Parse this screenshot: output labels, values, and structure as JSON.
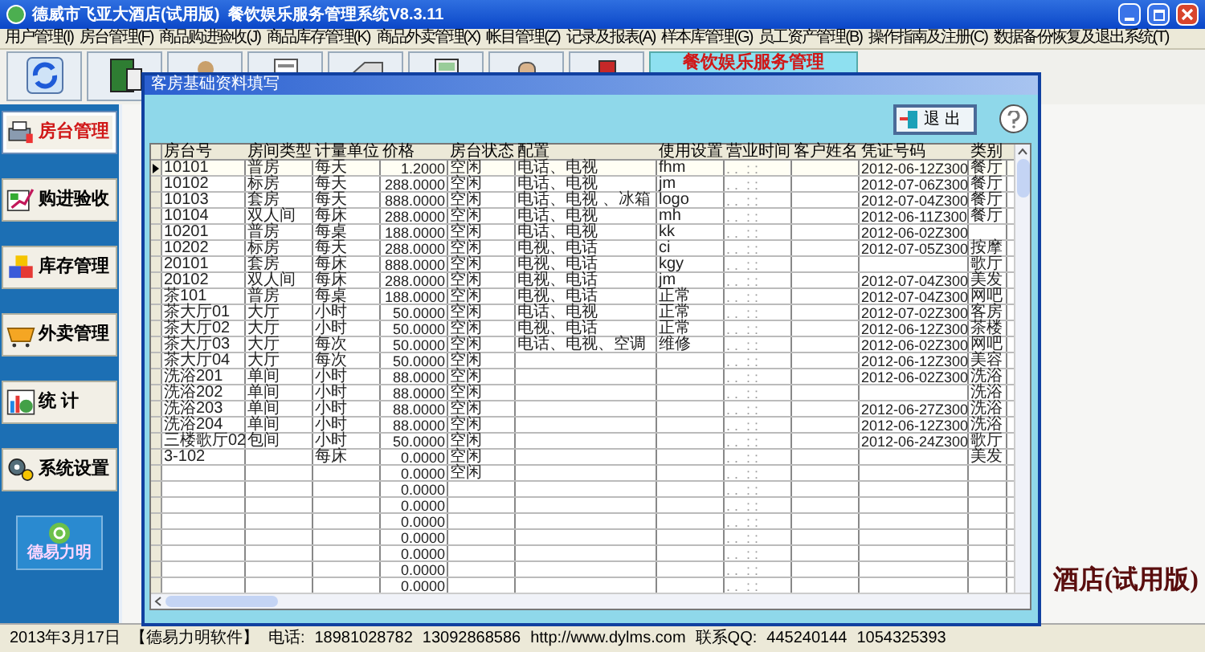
{
  "window": {
    "title": "德威市飞亚大酒店(试用版)  餐饮娱乐服务管理系统V8.3.11"
  },
  "menu": [
    "用户管理(I)",
    "房台管理(F)",
    "商品购进验收(J)",
    "商品库存管理(K)",
    "商品外卖管理(X)",
    "帐目管理(Z)",
    "记录及报表(A)",
    "样本库管理(G)",
    "员工资产管理(B)",
    "操作指南及注册(C)",
    "数据备份恢复及退出系统(T)"
  ],
  "toolbar": {
    "banner": "餐饮娱乐服务管理"
  },
  "sidebar": {
    "items": [
      {
        "label": "房台管理",
        "selected": true
      },
      {
        "label": "购进验收",
        "selected": false
      },
      {
        "label": "库存管理",
        "selected": false
      },
      {
        "label": "外卖管理",
        "selected": false
      },
      {
        "label": "统 计",
        "selected": false
      },
      {
        "label": "系统设置",
        "selected": false
      }
    ],
    "logo": "德易力明"
  },
  "dialog": {
    "title": "客房基础资料填写",
    "exit_button": "退 出",
    "table": {
      "columns": [
        "房台号",
        "房间类型",
        "计量单位",
        "价格",
        "房台状态",
        "配置",
        "使用设置",
        "营业时间",
        "客户姓名",
        "凭证号码",
        "类别"
      ],
      "rows": [
        {
          "selected": true,
          "room": "10101",
          "type": "普房",
          "unit": "每天",
          "price": "1.2000",
          "status": "空闲",
          "config": "电话、电视",
          "usage": "fhm",
          "time": ". .  : :",
          "voucher": "2012-06-12Z300",
          "category": "餐厅"
        },
        {
          "selected": false,
          "room": "10102",
          "type": "标房",
          "unit": "每天",
          "price": "288.0000",
          "status": "空闲",
          "config": "电话、电视",
          "usage": "jm",
          "time": ". .  : :",
          "voucher": "2012-07-06Z300",
          "category": "餐厅"
        },
        {
          "selected": false,
          "room": "10103",
          "type": "套房",
          "unit": "每天",
          "price": "888.0000",
          "status": "空闲",
          "config": "电话、电视 、冰箱",
          "usage": "logo",
          "time": ". .  : :",
          "voucher": "2012-07-04Z300",
          "category": "餐厅"
        },
        {
          "selected": false,
          "room": "10104",
          "type": "双人间",
          "unit": "每床",
          "price": "288.0000",
          "status": "空闲",
          "config": "电话、电视",
          "usage": "mh",
          "time": ". .  : :",
          "voucher": "2012-06-11Z300",
          "category": "餐厅"
        },
        {
          "selected": false,
          "room": "10201",
          "type": "普房",
          "unit": "每桌",
          "price": "188.0000",
          "status": "空闲",
          "config": "电话、电视",
          "usage": "kk",
          "time": ". .  : :",
          "voucher": "2012-06-02Z300"
        },
        {
          "selected": false,
          "room": "10202",
          "type": "标房",
          "unit": "每天",
          "price": "288.0000",
          "status": "空闲",
          "config": "电视、电话",
          "usage": "ci",
          "time": ". .  : :",
          "voucher": "2012-07-05Z300",
          "category": "按摩"
        },
        {
          "selected": false,
          "room": "20101",
          "type": "套房",
          "unit": "每床",
          "price": "888.0000",
          "status": "空闲",
          "config": "电视、电话",
          "usage": "kgy",
          "time": ". .  : :",
          "category": "歌厅"
        },
        {
          "selected": false,
          "room": "20102",
          "type": "双人间",
          "unit": "每床",
          "price": "288.0000",
          "status": "空闲",
          "config": "电视、电话",
          "usage": "jm",
          "time": ". .  : :",
          "voucher": "2012-07-04Z300",
          "category": "美发"
        },
        {
          "selected": false,
          "room": "茶101",
          "type": "普房",
          "unit": "每桌",
          "price": "188.0000",
          "status": "空闲",
          "config": "电视、电话",
          "usage": "正常",
          "time": ". .  : :",
          "voucher": "2012-07-04Z300",
          "category": "网吧"
        },
        {
          "selected": false,
          "room": "茶大厅01",
          "type": "大厅",
          "unit": "小时",
          "price": "50.0000",
          "status": "空闲",
          "config": "电话、电视",
          "usage": "正常",
          "time": ". .  : :",
          "voucher": "2012-07-02Z300",
          "category": "客房"
        },
        {
          "selected": false,
          "room": "茶大厅02",
          "type": "大厅",
          "unit": "小时",
          "price": "50.0000",
          "status": "空闲",
          "config": "电视、电话",
          "usage": "正常",
          "time": ". .  : :",
          "voucher": "2012-06-12Z300",
          "category": "茶楼"
        },
        {
          "selected": false,
          "room": "茶大厅03",
          "type": "大厅",
          "unit": "每次",
          "price": "50.0000",
          "status": "空闲",
          "config": "电话、电视、空调",
          "usage": "维修",
          "time": ". .  : :",
          "voucher": "2012-06-02Z300",
          "category": "网吧"
        },
        {
          "selected": false,
          "room": "茶大厅04",
          "type": "大厅",
          "unit": "每次",
          "price": "50.0000",
          "status": "空闲",
          "time": ". .  : :",
          "voucher": "2012-06-12Z300",
          "category": "美容"
        },
        {
          "selected": false,
          "room": "洗浴201",
          "type": "单间",
          "unit": "小时",
          "price": "88.0000",
          "status": "空闲",
          "time": ". .  : :",
          "voucher": "2012-06-02Z300",
          "category": "洗浴"
        },
        {
          "selected": false,
          "room": "洗浴202",
          "type": "单间",
          "unit": "小时",
          "price": "88.0000",
          "status": "空闲",
          "time": ". .  : :",
          "category": "洗浴"
        },
        {
          "selected": false,
          "room": "洗浴203",
          "type": "单间",
          "unit": "小时",
          "price": "88.0000",
          "status": "空闲",
          "time": ". .  : :",
          "voucher": "2012-06-27Z300",
          "category": "洗浴"
        },
        {
          "selected": false,
          "room": "洗浴204",
          "type": "单间",
          "unit": "小时",
          "price": "88.0000",
          "status": "空闲",
          "time": ". .  : :",
          "voucher": "2012-06-12Z300",
          "category": "洗浴"
        },
        {
          "selected": false,
          "room": "三楼歌厅02",
          "type": "包间",
          "unit": "小时",
          "price": "50.0000",
          "status": "空闲",
          "time": ". .  : :",
          "voucher": "2012-06-24Z300",
          "category": "歌厅"
        },
        {
          "selected": false,
          "room": "3-102",
          "unit": "每床",
          "price": "0.0000",
          "status": "空闲",
          "time": ". .  : :",
          "category": "美发"
        },
        {
          "selected": false,
          "price": "0.0000",
          "status": "空闲",
          "time": ". .  : :"
        },
        {
          "selected": false,
          "price": "0.0000",
          "time": ". .  : :"
        },
        {
          "selected": false,
          "price": "0.0000",
          "time": ". .  : :"
        },
        {
          "selected": false,
          "price": "0.0000",
          "time": ". .  : :"
        },
        {
          "selected": false,
          "price": "0.0000",
          "time": ". .  : :"
        },
        {
          "selected": false,
          "price": "0.0000",
          "time": ". .  : :"
        },
        {
          "selected": false,
          "price": "0.0000",
          "time": ". .  : :"
        },
        {
          "selected": false,
          "price": "0.0000",
          "time": ". .  : :"
        }
      ]
    }
  },
  "brand_text": "酒店(试用版)",
  "status_bar": [
    "2013年3月17日",
    "【德易力明软件】",
    "电话:",
    "18981028782",
    "13092868586",
    "http://www.dylms.com",
    "联系QQ:",
    "445240144",
    "1054325393"
  ]
}
